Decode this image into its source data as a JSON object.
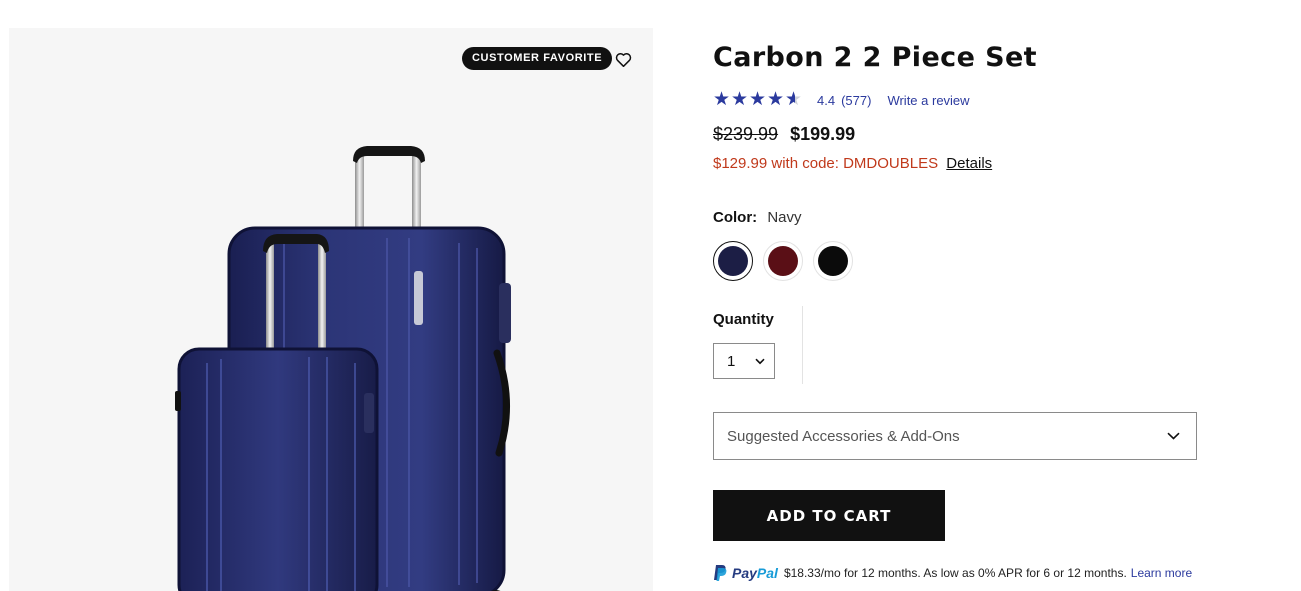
{
  "image_panel": {
    "badge": "CUSTOMER FAVORITE",
    "wishlist_icon": "heart-outline-icon"
  },
  "product": {
    "title": "Carbon 2 2 Piece Set",
    "rating": {
      "stars": 4.4,
      "value": "4.4",
      "count": "(577)",
      "write_review": "Write a review",
      "star_color": "#2b3a9e"
    },
    "price": {
      "original": "$239.99",
      "sale": "$199.99"
    },
    "promo": {
      "text": "$129.99 with code: DMDOUBLES",
      "details": "Details",
      "color": "#c0391b"
    },
    "color": {
      "label": "Color:",
      "selected": "Navy",
      "swatches": [
        {
          "name": "Navy",
          "hex": "#1c1e45",
          "selected": true
        },
        {
          "name": "Burgundy",
          "hex": "#5a0f16",
          "selected": false
        },
        {
          "name": "Black",
          "hex": "#0b0b0b",
          "selected": false
        }
      ]
    },
    "quantity": {
      "label": "Quantity",
      "value": "1"
    },
    "accessories": {
      "label": "Suggested Accessories & Add-Ons"
    },
    "add_to_cart": "ADD TO CART",
    "paypal": {
      "pay": "Pay",
      "pal": "Pal",
      "text": "$18.33/mo for 12 months. As low as 0% APR for 6 or 12 months.",
      "learn_more": "Learn more"
    }
  }
}
